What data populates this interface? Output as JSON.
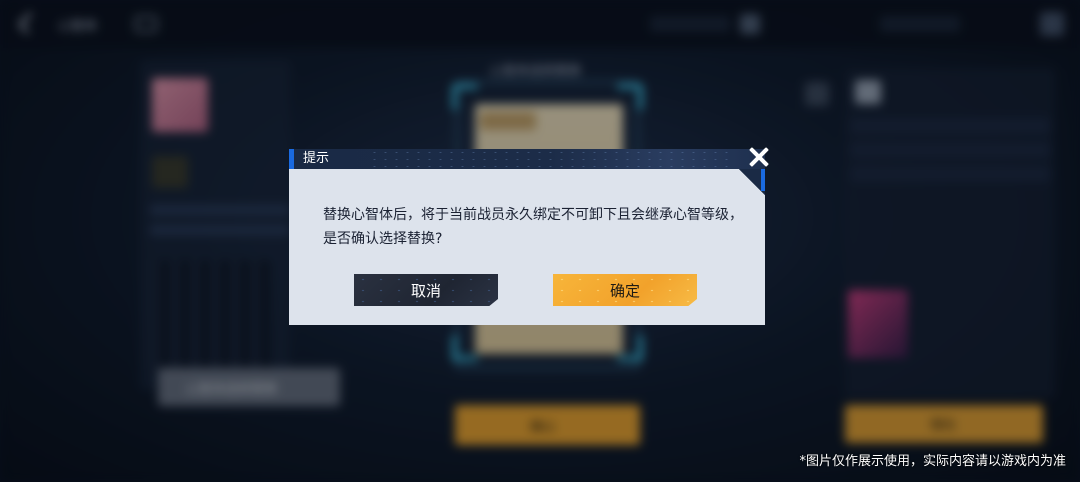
{
  "background": {
    "top_bar_title": "心智体",
    "center_title": "心智体选择更换",
    "center_confirm": "确认",
    "left_button": "心智体选择更换",
    "right_button": "强化"
  },
  "dialog": {
    "title": "提示",
    "message": "替换心智体后，将于当前战员永久绑定不可卸下且会继承心智等级，是否确认选择替换?",
    "cancel_label": "取消",
    "confirm_label": "确定",
    "close_icon": "close-x-icon"
  },
  "disclaimer": "*图片仅作展示使用，实际内容请以游戏内为准",
  "colors": {
    "header_bg": "#1a2a45",
    "header_accent": "#1a6ae0",
    "dialog_bg": "#dde3ec",
    "cancel_bg": "#232a38",
    "confirm_bg": "#f2a22b"
  }
}
